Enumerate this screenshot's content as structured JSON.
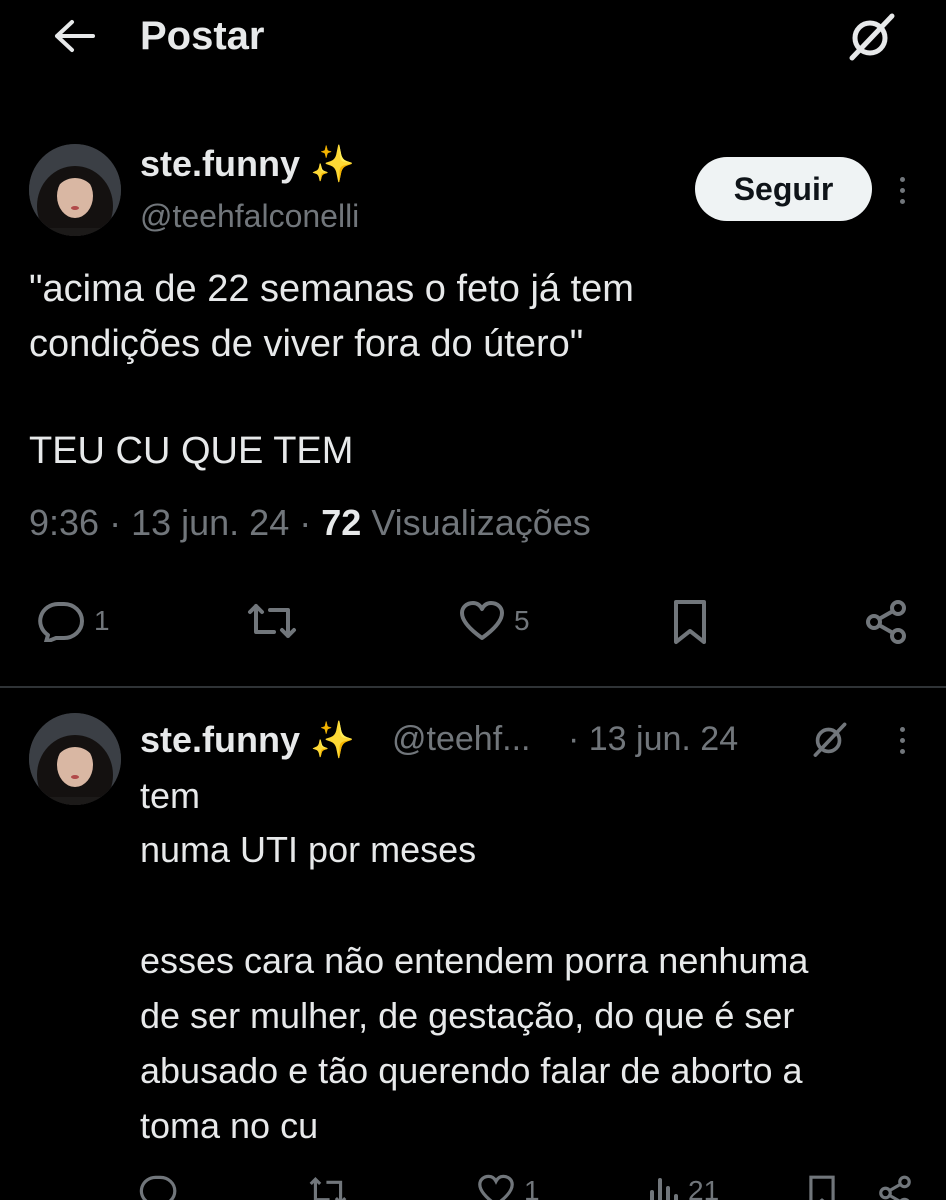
{
  "header": {
    "title": "Postar"
  },
  "icons": {
    "back": "arrow-left-icon",
    "grok": "grok-icon",
    "reply": "comment-icon",
    "repost": "repost-icon",
    "like": "heart-icon",
    "bookmark": "bookmark-icon",
    "share": "share-icon",
    "views": "bar-chart-icon",
    "more": "more-vertical-icon"
  },
  "colors": {
    "background": "#000000",
    "text": "#e7e9ea",
    "muted": "#71767b",
    "follow_button_bg": "#eff3f4",
    "sparkle": "#f4c542"
  },
  "main_post": {
    "display_name": "ste.funny",
    "emoji": "✨",
    "handle": "@teehfalconelli",
    "follow_label": "Seguir",
    "text_lines": [
      "\"acima de 22 semanas o feto já tem",
      "condições de viver fora do útero\"",
      "TEU CU QUE TEM"
    ],
    "time": "9:36",
    "date": "13 jun. 24",
    "views_count": "72",
    "views_label": "Visualizações",
    "reply_count": "1",
    "like_count": "5"
  },
  "reply_post": {
    "display_name": "ste.funny",
    "emoji": "✨",
    "handle": "@teehf...",
    "date": "· 13 jun. 24",
    "text_lines": [
      "tem",
      "numa UTI por meses",
      "esses cara não entendem porra nenhuma",
      "de ser mulher, de gestação, do que é ser",
      "abusado e tão querendo falar de aborto a",
      "toma no cu"
    ],
    "like_count": "1",
    "views_count": "21"
  }
}
